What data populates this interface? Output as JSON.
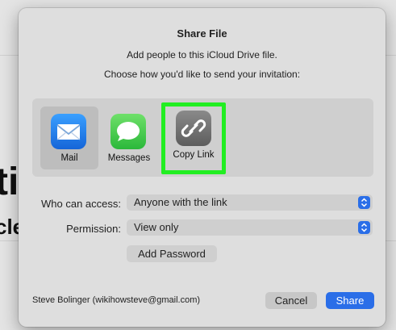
{
  "dialog": {
    "title": "Share File",
    "subtitle": "Add people to this iCloud Drive file.",
    "instruction": "Choose how you'd like to send your invitation:"
  },
  "share_options": [
    {
      "label": "Mail",
      "icon": "mail-icon"
    },
    {
      "label": "Messages",
      "icon": "messages-icon"
    },
    {
      "label": "Copy Link",
      "icon": "link-icon"
    }
  ],
  "access": {
    "label": "Who can access:",
    "value": "Anyone with the link"
  },
  "permission": {
    "label": "Permission:",
    "value": "View only"
  },
  "add_password_label": "Add Password",
  "account": "Steve Bolinger (wikihowsteve@gmail.com)",
  "buttons": {
    "cancel": "Cancel",
    "share": "Share"
  },
  "background": {
    "fragment_1": "ti",
    "fragment_2": "cle"
  },
  "colors": {
    "accent": "#2a6ee8",
    "highlight": "#22ee22"
  }
}
